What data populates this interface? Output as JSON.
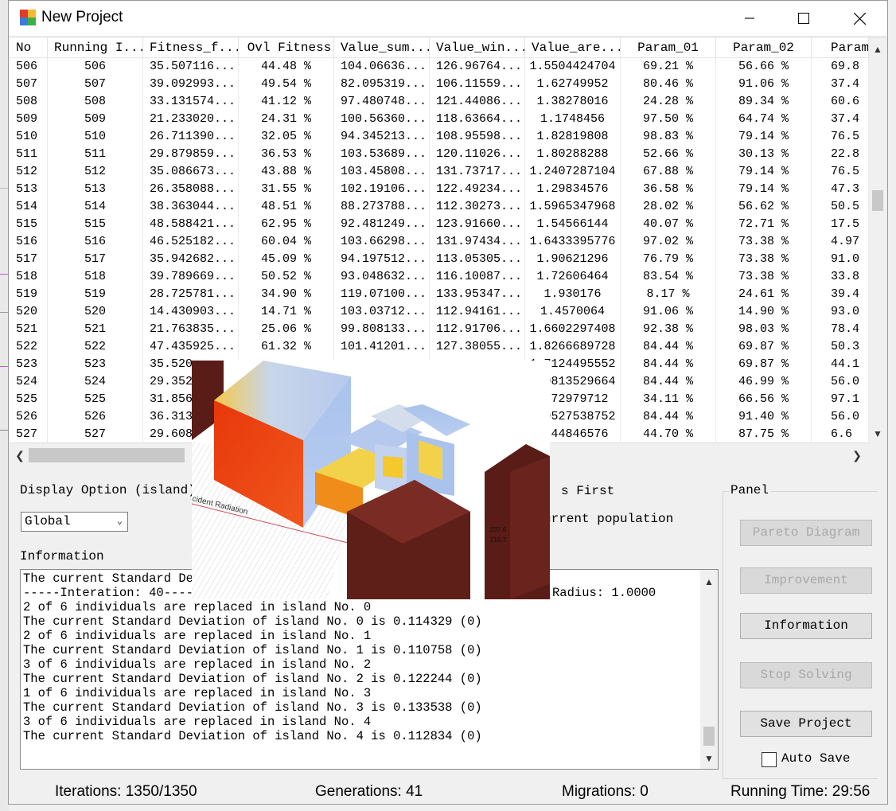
{
  "window": {
    "title": "New Project"
  },
  "columns": [
    "No",
    "Running I...",
    "Fitness_f...",
    "Ovl Fitness",
    "Value_sum...",
    "Value_win...",
    "Value_are...",
    "Param_01",
    "Param_02",
    "Param"
  ],
  "rows": [
    [
      "506",
      "506",
      "35.507116...",
      "44.48 %",
      "104.06636...",
      "126.96764...",
      "1.5504424704",
      "69.21 %",
      "56.66 %",
      "69.8"
    ],
    [
      "507",
      "507",
      "39.092993...",
      "49.54 %",
      "82.095319...",
      "106.11559...",
      "1.62749952",
      "80.46 %",
      "91.06 %",
      "37.4"
    ],
    [
      "508",
      "508",
      "33.131574...",
      "41.12 %",
      "97.480748...",
      "121.44086...",
      "1.38278016",
      "24.28 %",
      "89.34 %",
      "60.6"
    ],
    [
      "509",
      "509",
      "21.233020...",
      "24.31 %",
      "100.56360...",
      "118.63664...",
      "1.1748456",
      "97.50 %",
      "64.74 %",
      "37.4"
    ],
    [
      "510",
      "510",
      "26.711390...",
      "32.05 %",
      "94.345213...",
      "108.95598...",
      "1.82819808",
      "98.83 %",
      "79.14 %",
      "76.5"
    ],
    [
      "511",
      "511",
      "29.879859...",
      "36.53 %",
      "103.53689...",
      "120.11026...",
      "1.80288288",
      "52.66 %",
      "30.13 %",
      "22.8"
    ],
    [
      "512",
      "512",
      "35.086673...",
      "43.88 %",
      "103.45808...",
      "131.73717...",
      "1.2407287104",
      "67.88 %",
      "79.14 %",
      "76.5"
    ],
    [
      "513",
      "513",
      "26.358088...",
      "31.55 %",
      "102.19106...",
      "122.49234...",
      "1.29834576",
      "36.58 %",
      "79.14 %",
      "47.3"
    ],
    [
      "514",
      "514",
      "38.363044...",
      "48.51 %",
      "88.273788...",
      "112.30273...",
      "1.5965347968",
      "28.02 %",
      "56.62 %",
      "50.5"
    ],
    [
      "515",
      "515",
      "48.588421...",
      "62.95 %",
      "92.481249...",
      "123.91660...",
      "1.54566144",
      "40.07 %",
      "72.71 %",
      "17.5"
    ],
    [
      "516",
      "516",
      "46.525182...",
      "60.04 %",
      "103.66298...",
      "131.97434...",
      "1.6433395776",
      "97.02 %",
      "73.38 %",
      "4.97"
    ],
    [
      "517",
      "517",
      "35.942682...",
      "45.09 %",
      "94.197512...",
      "113.05305...",
      "1.90621296",
      "76.79 %",
      "73.38 %",
      "91.0"
    ],
    [
      "518",
      "518",
      "39.789669...",
      "50.52 %",
      "93.048632...",
      "116.10087...",
      "1.72606464",
      "83.54 %",
      "73.38 %",
      "33.8"
    ],
    [
      "519",
      "519",
      "28.725781...",
      "34.90 %",
      "119.07100...",
      "133.95347...",
      "1.930176",
      "8.17 %",
      "24.61 %",
      "39.4"
    ],
    [
      "520",
      "520",
      "14.430903...",
      "14.71 %",
      "103.03712...",
      "112.94161...",
      "1.4570064",
      "91.06 %",
      "14.90 %",
      "93.0"
    ],
    [
      "521",
      "521",
      "21.763835...",
      "25.06 %",
      "99.808133...",
      "112.91706...",
      "1.6602297408",
      "92.38 %",
      "98.03 %",
      "78.4"
    ],
    [
      "522",
      "522",
      "47.435925...",
      "61.32 %",
      "101.41201...",
      "127.38055...",
      "1.8266689728",
      "84.44 %",
      "69.87 %",
      "50.3"
    ],
    [
      "523",
      "523",
      "35.520",
      "",
      "",
      "",
      "1.7124495552",
      "84.44 %",
      "69.87 %",
      "44.1"
    ],
    [
      "524",
      "524",
      "29.352",
      "",
      "",
      "",
      "1.9813529664",
      "84.44 %",
      "46.99 %",
      "56.0"
    ],
    [
      "525",
      "525",
      "31.856",
      "",
      "",
      "",
      "1.72979712",
      "34.11 %",
      "66.56 %",
      "97.1"
    ],
    [
      "526",
      "526",
      "36.313",
      "",
      "",
      "",
      "1.9527538752",
      "84.44 %",
      "91.40 %",
      "56.0"
    ],
    [
      "527",
      "527",
      "29.608",
      "",
      "",
      "",
      "1.44846576",
      "44.70 %",
      "87.75 %",
      "6.6"
    ]
  ],
  "display_option": {
    "label": "Display Option (island)",
    "value": "Global"
  },
  "first_label": "s First",
  "population_label": "urrent population",
  "information": {
    "label": "Information",
    "radius_text": "Radius: 1.0000",
    "lines": [
      "The current Standard Devi",
      "-----Interation: 40-----",
      "2 of 6 individuals are replaced in island No. 0",
      "The current Standard Deviation of island No. 0 is 0.114329 (0)",
      "2 of 6 individuals are replaced in island No. 1",
      "The current Standard Deviation of island No. 1 is 0.110758 (0)",
      "3 of 6 individuals are replaced in island No. 2",
      "The current Standard Deviation of island No. 2 is 0.122244 (0)",
      "1 of 6 individuals are replaced in island No. 3",
      "The current Standard Deviation of island No. 3 is 0.133538 (0)",
      "3 of 6 individuals are replaced in island No. 4",
      "The current Standard Deviation of island No. 4 is 0.112834 (0)"
    ]
  },
  "panel": {
    "title": "Panel",
    "pareto": "Pareto Diagram",
    "improvement": "Improvement",
    "information": "Information",
    "stop": "Stop Solving",
    "save": "Save Project",
    "auto_save": "Auto Save"
  },
  "status": {
    "iterations": "Iterations: 1350/1350",
    "generations": "Generations: 41",
    "migrations": "Migrations: 0",
    "running_time": "Running Time: 29:56"
  },
  "overlay": {
    "radiation_label": "cident Radiation",
    "legend_values": [
      "237.6",
      "218.7"
    ]
  },
  "colors": {
    "title_bg": "#ffffff",
    "window_bg": "#f0f0f0",
    "disabled_text": "#a8a8a8",
    "radiation_hot": "#e8380c",
    "building_blue": "#a8c0e8",
    "building_dark": "#5a1a14"
  }
}
